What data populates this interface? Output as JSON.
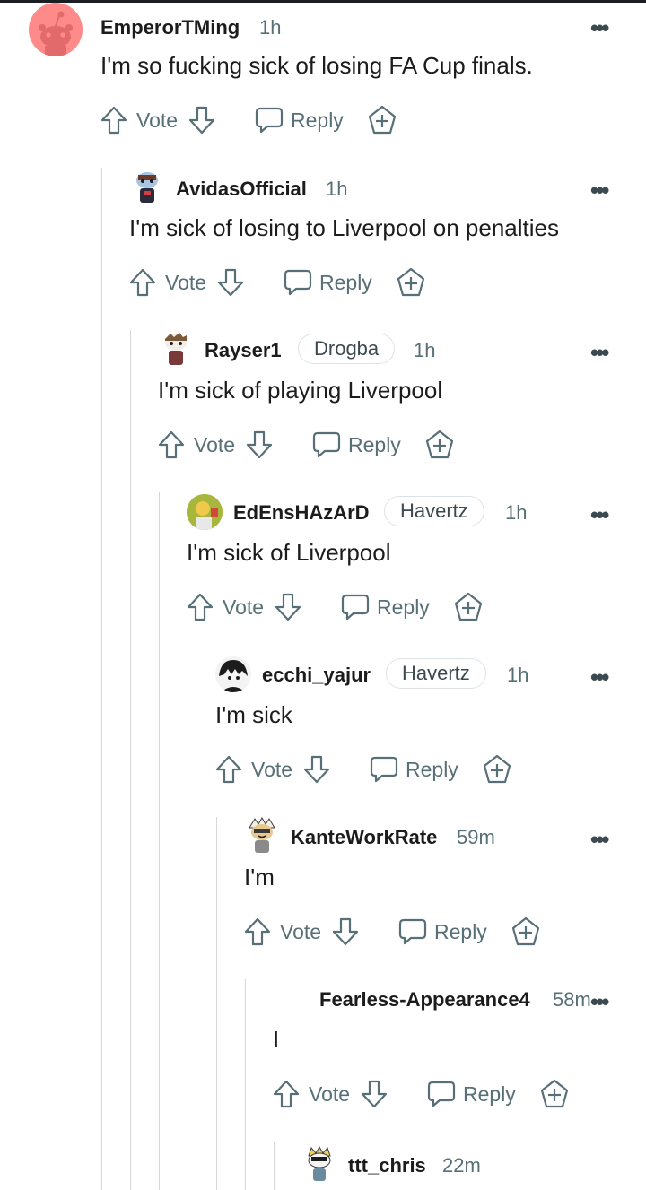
{
  "actions": {
    "vote_label": "Vote",
    "reply_label": "Reply"
  },
  "comments": [
    {
      "username": "EmperorTMing",
      "time": "1h",
      "flair": "",
      "text": "I'm so fucking sick of losing FA Cup finals."
    },
    {
      "username": "AvidasOfficial",
      "time": "1h",
      "flair": "",
      "text": "I'm sick of losing to Liverpool on penalties"
    },
    {
      "username": "Rayser1",
      "time": "1h",
      "flair": "Drogba",
      "text": "I'm sick of playing Liverpool"
    },
    {
      "username": "EdEnsHAzArD",
      "time": "1h",
      "flair": "Havertz",
      "text": "I'm sick of Liverpool"
    },
    {
      "username": "ecchi_yajur",
      "time": "1h",
      "flair": "Havertz",
      "text": "I'm sick"
    },
    {
      "username": "KanteWorkRate",
      "time": "59m",
      "flair": "",
      "text": "I'm"
    },
    {
      "username": "Fearless-Appearance4",
      "time": "58m",
      "flair": "",
      "text": "I"
    },
    {
      "username": "ttt_chris",
      "time": "22m",
      "flair": "",
      "text": ""
    }
  ],
  "colors": {
    "muted": "#576f76",
    "thread_line": "#d5d7da",
    "default_avatar_bg": "#ff8585"
  }
}
